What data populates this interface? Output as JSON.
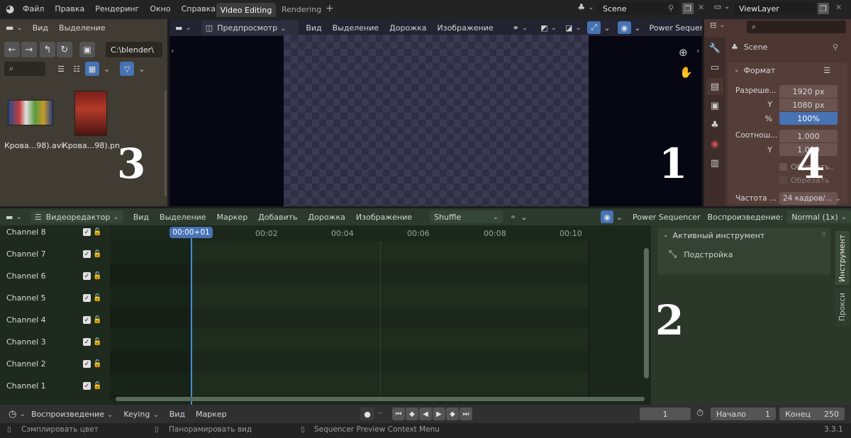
{
  "topbar": {
    "menu": [
      "Файл",
      "Правка",
      "Рендеринг",
      "Окно",
      "Справка"
    ],
    "tabs": [
      "Video Editing",
      "Rendering"
    ],
    "scene_name": "Scene",
    "view_layer_name": "ViewLayer"
  },
  "file_browser": {
    "menu": [
      "Вид",
      "Выделение"
    ],
    "path": "C:\\blender\\",
    "files": [
      {
        "name": "Крова...98).avi"
      },
      {
        "name": "Крова...98).pn"
      }
    ],
    "area_number": "3"
  },
  "preview": {
    "mode_label": "Предпросмотр",
    "menu": [
      "Вид",
      "Выделение",
      "Дорожка",
      "Изображение"
    ],
    "power_sequencer": "Power Sequencer",
    "area_number": "1"
  },
  "properties": {
    "scene_label": "Scene",
    "panel_title": "Формат",
    "rows": [
      {
        "label": "Разреше...",
        "value": "1920 px"
      },
      {
        "label": "Y",
        "value": "1080 px"
      },
      {
        "label": "%",
        "value": "100%"
      },
      {
        "label": "Соотнош...",
        "value": "1.000"
      },
      {
        "label": "Y",
        "value": "1.000"
      }
    ],
    "checkbox1": "Обрезать...",
    "checkbox2": "Обрезать",
    "frame_rate_label": "Частота ...",
    "frame_rate_value": "24 кадров/...",
    "area_number": "4"
  },
  "sequencer": {
    "editor_label": "Видеоредактор",
    "menu": [
      "Вид",
      "Выделение",
      "Маркер",
      "Добавить",
      "Дорожка",
      "Изображение"
    ],
    "shuffle": "Shuffle",
    "power_sequencer": "Power Sequencer",
    "playback_label": "Воспроизведение:",
    "playback_value": "Normal (1x)",
    "current_time": "00:00+01",
    "ticks": [
      "00:02",
      "00:04",
      "00:06",
      "00:08",
      "00:10"
    ],
    "channels": [
      "Channel 8",
      "Channel 7",
      "Channel 6",
      "Channel 5",
      "Channel 4",
      "Channel 3",
      "Channel 2",
      "Channel 1"
    ],
    "area_number": "2"
  },
  "sidebar": {
    "panel_title": "Активный инструмент",
    "tool_name": "Подстройка",
    "tab_tool": "Инструмент",
    "tab_proxy": "Прокси"
  },
  "timeline": {
    "menu": [
      "Воспроизведение",
      "Keying",
      "Вид",
      "Маркер"
    ],
    "current_frame": "1",
    "start_label": "Начало",
    "start_value": "1",
    "end_label": "Конец",
    "end_value": "250"
  },
  "status": {
    "items": [
      "Сэмплировать цвет",
      "Панорамировать вид",
      "Sequencer Preview Context Menu"
    ],
    "version": "3.3.1"
  }
}
